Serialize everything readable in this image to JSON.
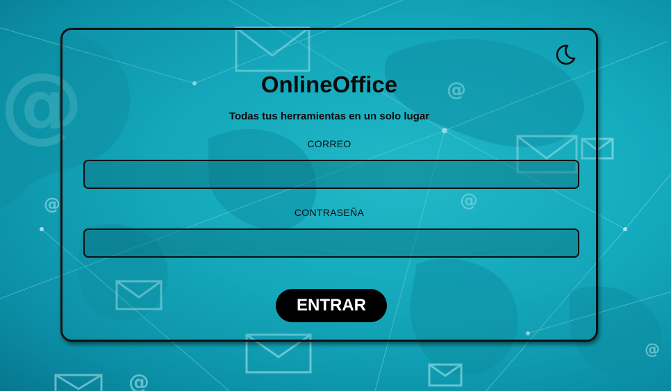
{
  "app": {
    "title": "OnlineOffice",
    "subtitle": "Todas tus herramientas en un solo lugar"
  },
  "form": {
    "email_label": "CORREO",
    "email_value": "",
    "password_label": "CONTRASEÑA",
    "password_value": "",
    "submit_label": "ENTRAR"
  },
  "icons": {
    "theme_toggle": "moon-icon"
  },
  "colors": {
    "background_accent": "#14aabd",
    "text": "#0b0b0b",
    "button_bg": "#000000",
    "button_text": "#ffffff"
  }
}
